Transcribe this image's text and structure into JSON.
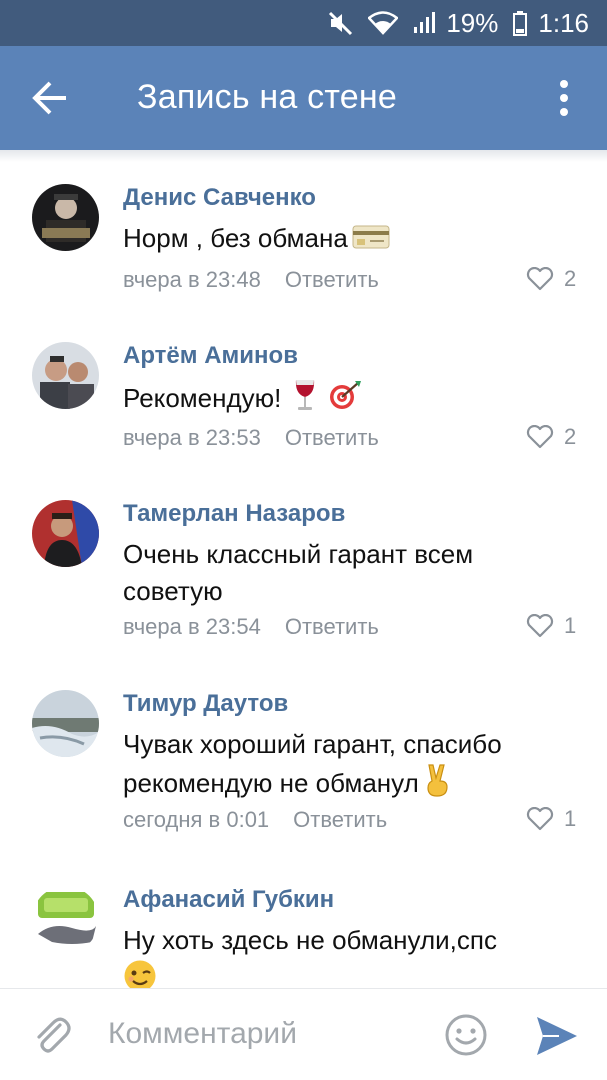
{
  "status_bar": {
    "battery": "19%",
    "time": "1:16",
    "icons": [
      "mute-icon",
      "wifi-icon",
      "signal-icon",
      "battery-icon"
    ]
  },
  "header": {
    "title": "Запись на стене",
    "back_icon": "arrow-left-icon",
    "menu_icon": "more-vertical-icon"
  },
  "comments": [
    {
      "author": "Денис Савченко",
      "text": "Норм , без обмана",
      "emoji": "credit-card-emoji",
      "time": "вчера в 23:48",
      "reply": "Ответить",
      "likes": "2"
    },
    {
      "author": "Артём Аминов",
      "text": "Рекомендую!",
      "emoji": "wine-glass-and-target-emoji",
      "time": "вчера в 23:53",
      "reply": "Ответить",
      "likes": "2"
    },
    {
      "author": "Тамерлан Назаров",
      "text": "Очень классный гарант всем советую",
      "time": "вчера в 23:54",
      "reply": "Ответить",
      "likes": "1"
    },
    {
      "author": "Тимур Даутов",
      "text": "Чувак хороший гарант, спасибо рекомендую не обманул",
      "emoji": "victory-hand-emoji",
      "time": "сегодня в 0:01",
      "reply": "Ответить",
      "likes": "1"
    },
    {
      "author": "Афанасий Губкин",
      "text": "Ну хоть здесь не обманули,спс",
      "emoji": "winking-face-emoji"
    }
  ],
  "input_bar": {
    "placeholder": "Комментарий",
    "attach_icon": "paperclip-icon",
    "emoji_icon": "smile-icon",
    "send_icon": "send-icon"
  },
  "colors": {
    "status_bar": "#415b7d",
    "header": "#5b83b8",
    "author_link": "#4a6f99",
    "meta": "#8a9199",
    "send": "#5b83b8"
  }
}
